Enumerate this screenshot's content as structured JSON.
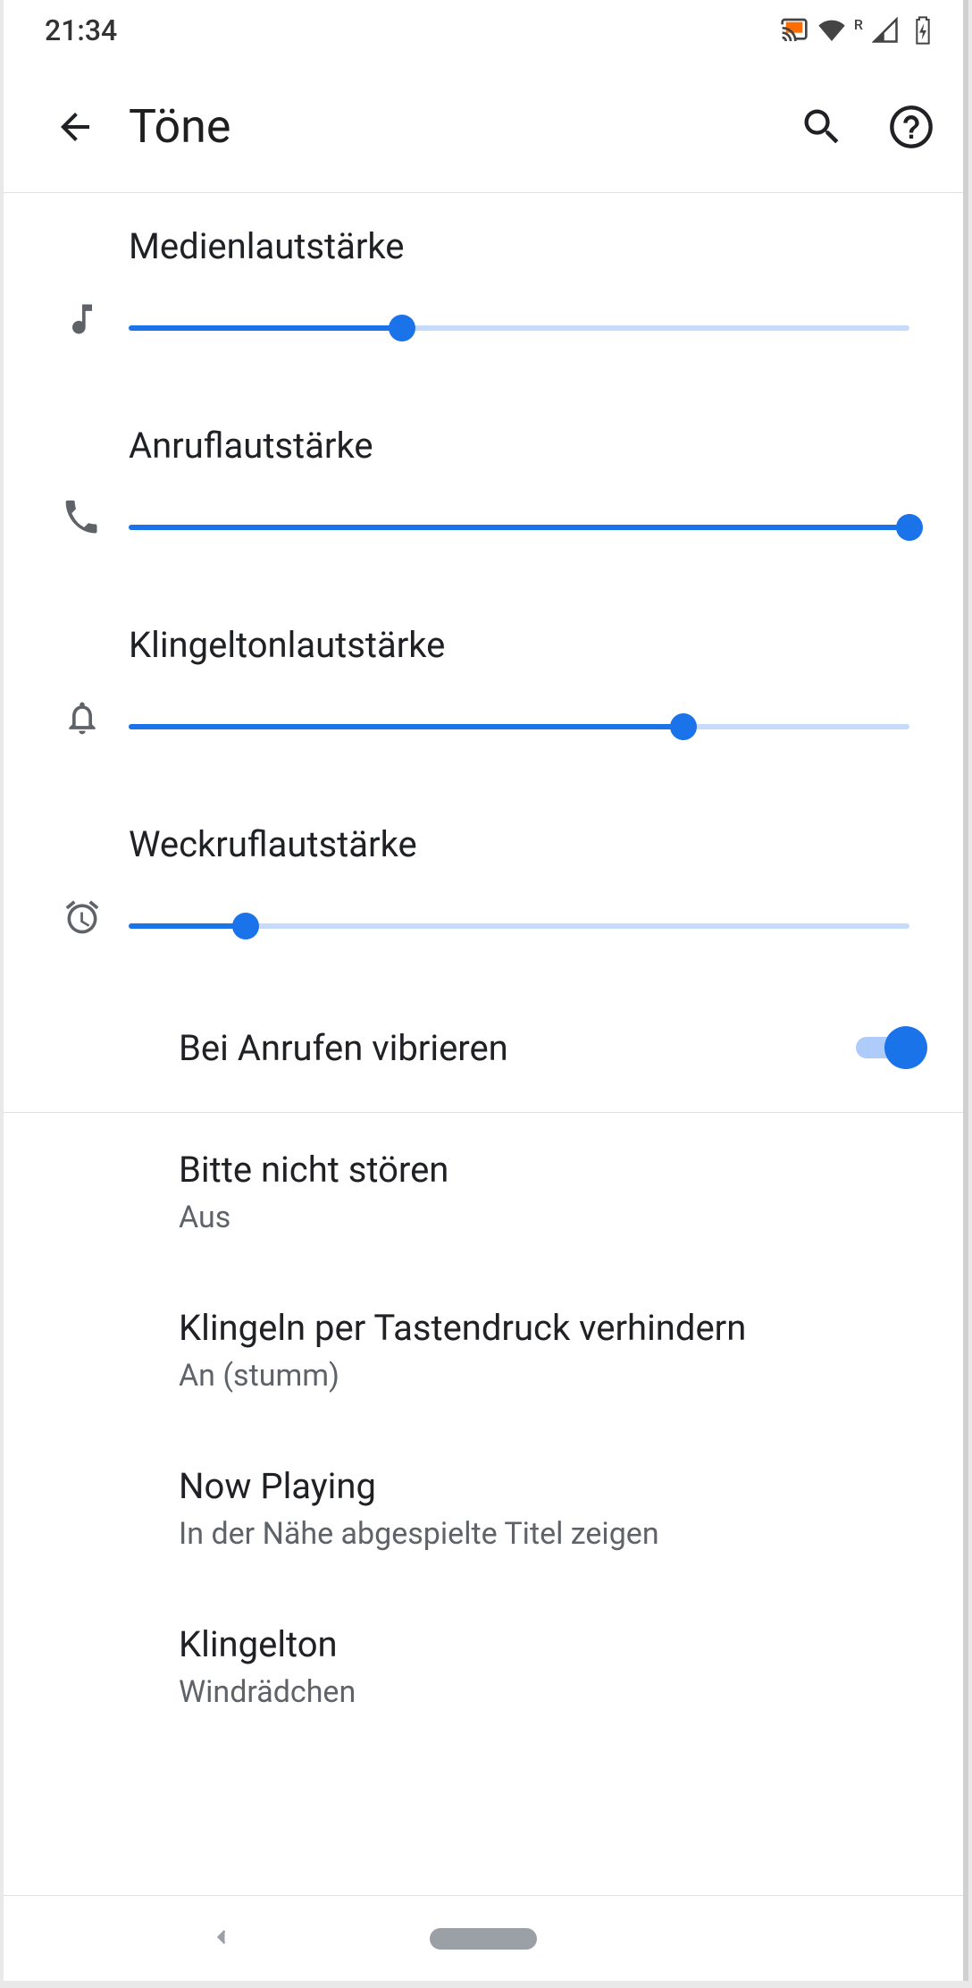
{
  "status": {
    "time": "21:34",
    "roaming": "R"
  },
  "appbar": {
    "title": "Töne"
  },
  "sliders": {
    "media": {
      "label": "Medienlautstärke",
      "value": 35
    },
    "call": {
      "label": "Anruflautstärke",
      "value": 100
    },
    "ring": {
      "label": "Klingeltonlautstärke",
      "value": 71
    },
    "alarm": {
      "label": "Weckruflautstärke",
      "value": 15
    }
  },
  "toggle": {
    "vibrate": {
      "label": "Bei Anrufen vibrieren",
      "on": true
    }
  },
  "list": {
    "dnd": {
      "title": "Bitte nicht stören",
      "sub": "Aus"
    },
    "prevent": {
      "title": "Klingeln per Tastendruck verhindern",
      "sub": "An (stumm)"
    },
    "nowplay": {
      "title": "Now Playing",
      "sub": "In der Nähe abgespielte Titel zeigen"
    },
    "ring": {
      "title": "Klingelton",
      "sub": "Windrädchen"
    }
  }
}
